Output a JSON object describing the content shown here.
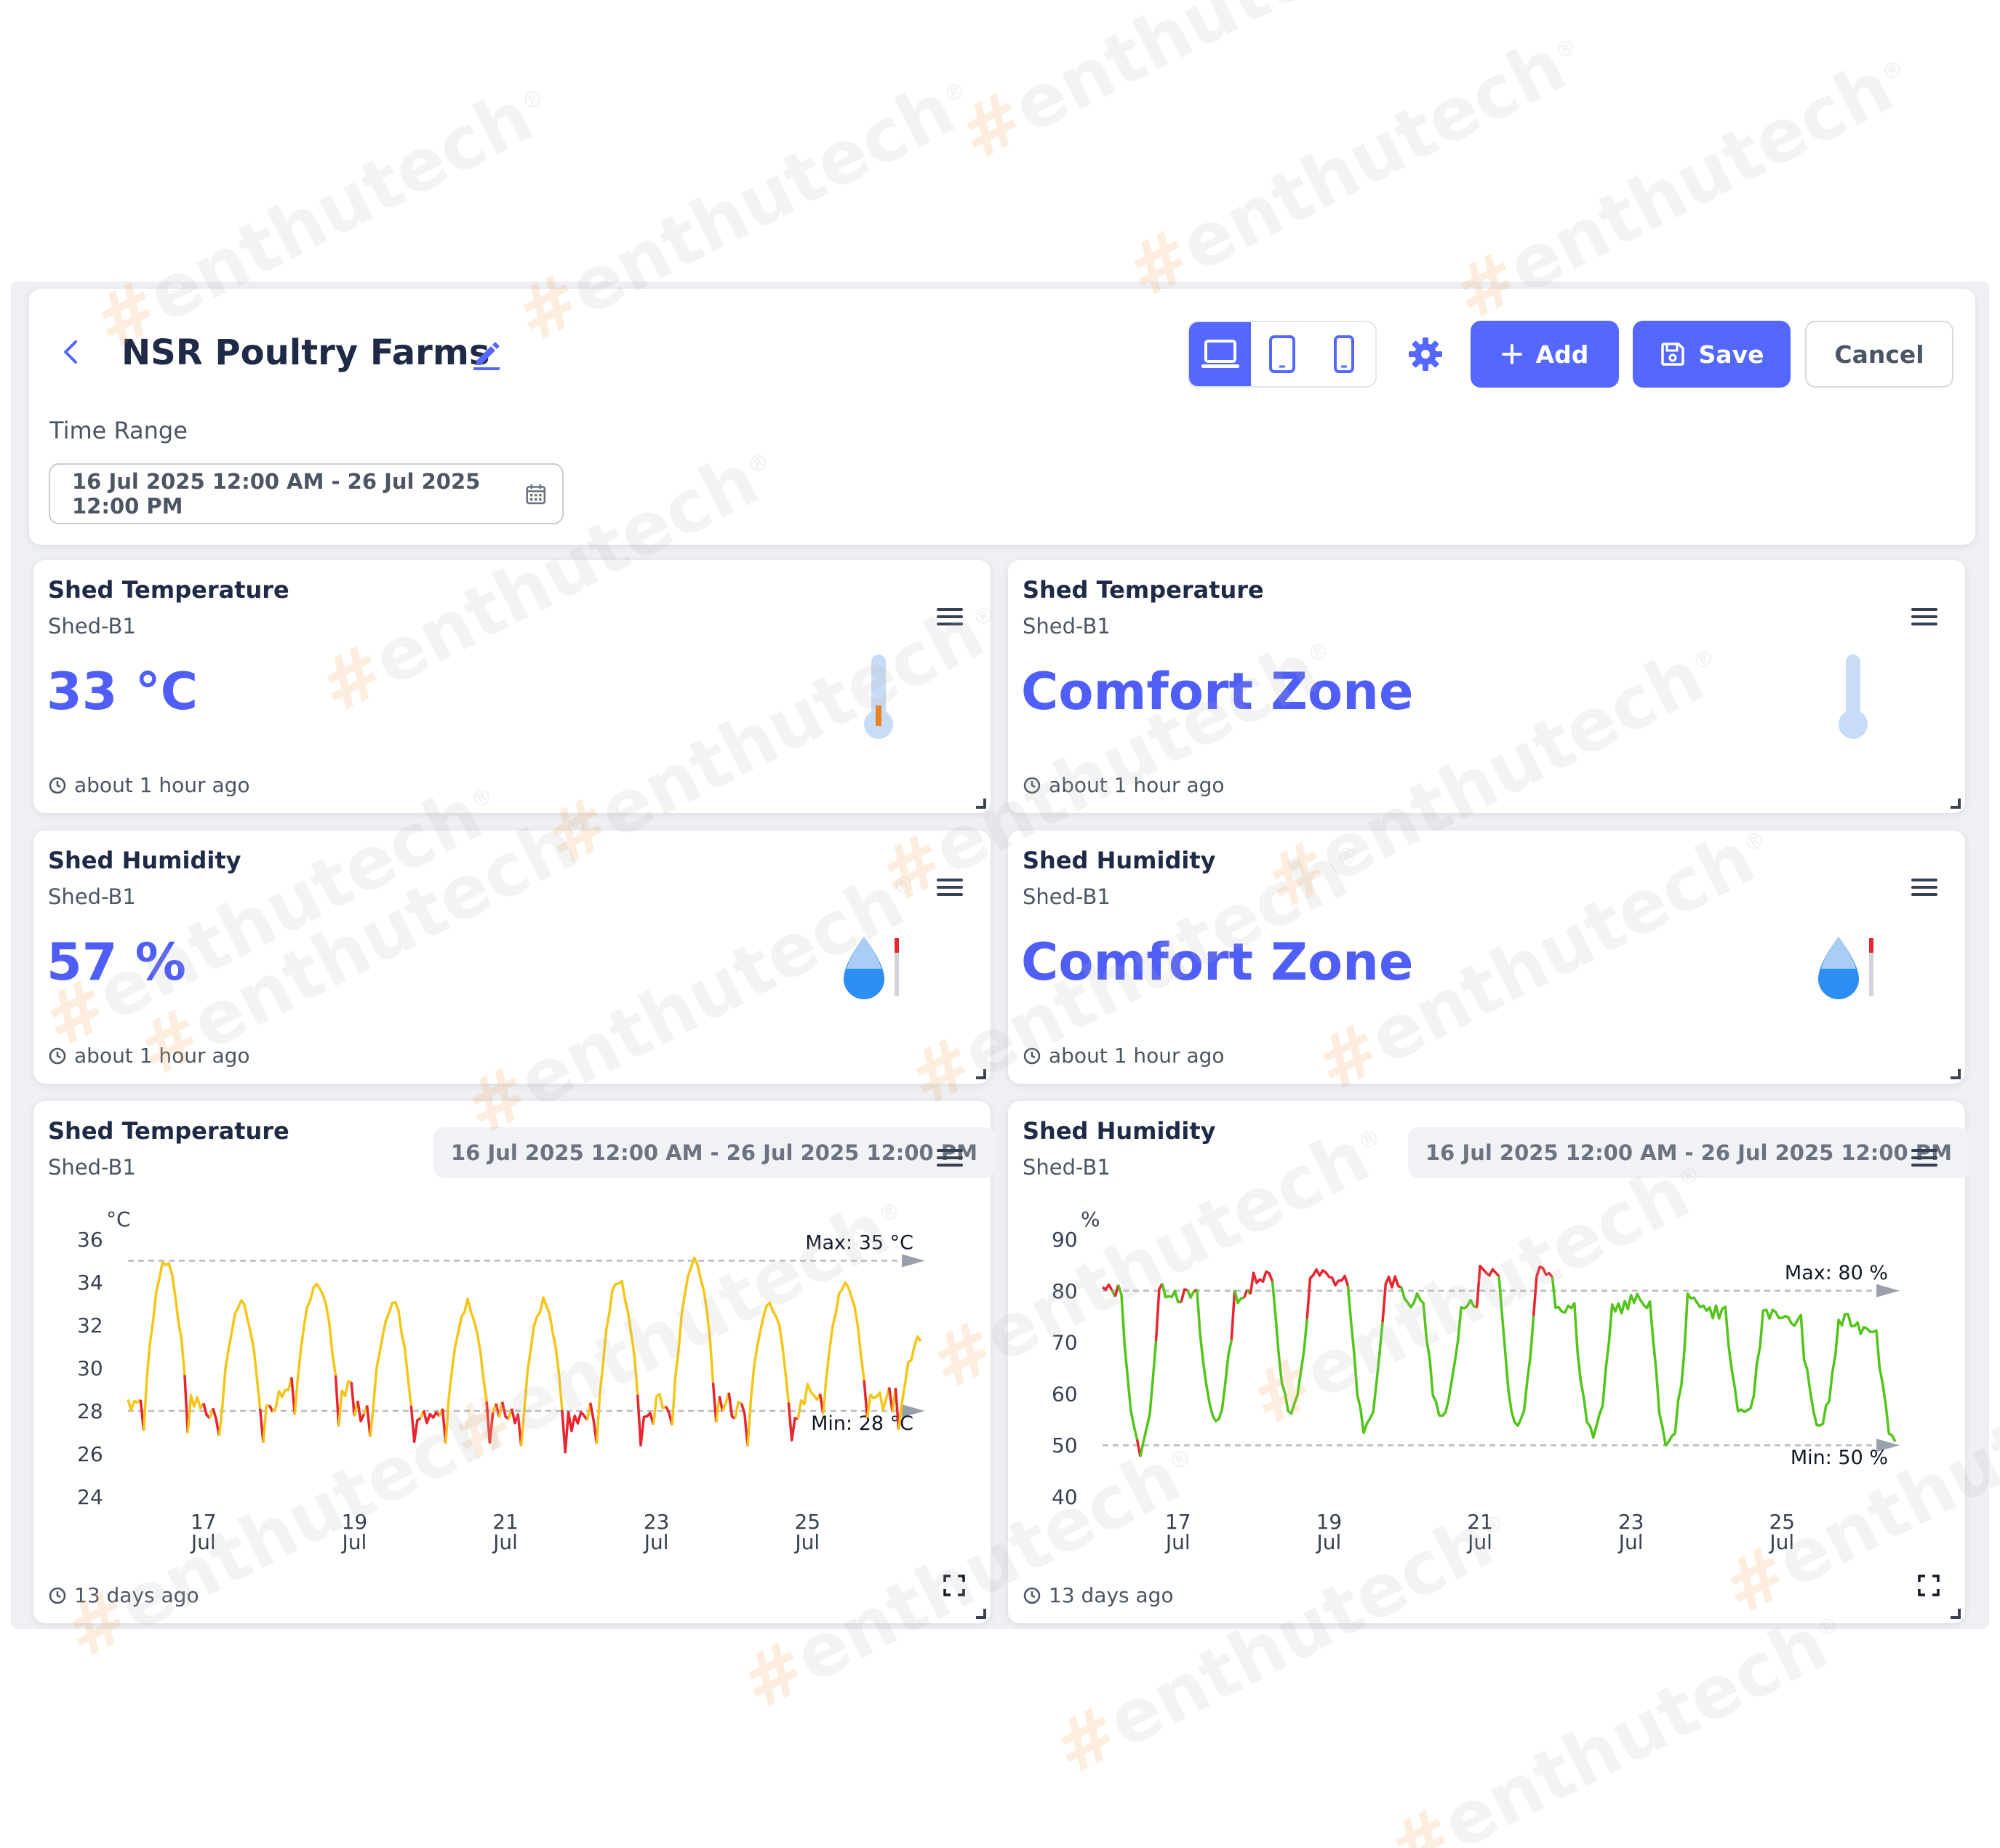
{
  "header": {
    "title": "NSR Poultry Farms",
    "add_label": "Add",
    "save_label": "Save",
    "cancel_label": "Cancel",
    "accent_color": "#5468ff"
  },
  "time_range": {
    "label": "Time Range",
    "value": "16 Jul 2025 12:00 AM - 26 Jul 2025 12:00 PM"
  },
  "widgets": {
    "temp_value": {
      "title": "Shed Temperature",
      "subtitle": "Shed-B1",
      "value": "33 °C",
      "updated": "about 1 hour ago"
    },
    "temp_zone": {
      "title": "Shed Temperature",
      "subtitle": "Shed-B1",
      "value": "Comfort Zone",
      "updated": "about 1 hour ago"
    },
    "hum_value": {
      "title": "Shed Humidity",
      "subtitle": "Shed-B1",
      "value": "57 %",
      "updated": "about 1 hour ago"
    },
    "hum_zone": {
      "title": "Shed Humidity",
      "subtitle": "Shed-B1",
      "value": "Comfort Zone",
      "updated": "about 1 hour ago"
    },
    "temp_chart": {
      "title": "Shed Temperature",
      "subtitle": "Shed-B1",
      "range": "16 Jul 2025 12:00 AM - 26 Jul 2025 12:00 PM",
      "updated": "13 days ago"
    },
    "hum_chart": {
      "title": "Shed Humidity",
      "subtitle": "Shed-B1",
      "range": "16 Jul 2025 12:00 AM - 26 Jul 2025 12:00 PM",
      "updated": "13 days ago"
    }
  },
  "watermark": {
    "hash": "#",
    "text": "enthutech",
    "mark": "®"
  },
  "chart_data": [
    {
      "type": "line",
      "title": "",
      "unit": "°C",
      "x_tick_days": [
        17,
        19,
        21,
        23,
        25
      ],
      "x_tick_month": "Jul",
      "ylim": [
        24,
        36
      ],
      "yticks": [
        24,
        26,
        28,
        30,
        32,
        34,
        36
      ],
      "max": {
        "value": 35,
        "label": "Max:  35 °C"
      },
      "min": {
        "value": 28,
        "label": "Min: 28 °C"
      },
      "color_above_min": "#f5c518",
      "color_below_min": "#e8242f",
      "x_start_day": 16,
      "x_end_day": 26.5,
      "day_peaks": [
        35,
        33,
        34,
        33,
        33,
        33,
        34,
        35,
        33,
        34,
        31.5
      ],
      "day_troughs": [
        26.5,
        26,
        27,
        26,
        26,
        25.5,
        26,
        26.5,
        26,
        27,
        26.5
      ]
    },
    {
      "type": "line",
      "title": "",
      "unit": "%",
      "x_tick_days": [
        17,
        19,
        21,
        23,
        25
      ],
      "x_tick_month": "Jul",
      "ylim": [
        40,
        90
      ],
      "yticks": [
        40,
        50,
        60,
        70,
        80,
        90
      ],
      "max": {
        "value": 80,
        "label": "Max:  80 %"
      },
      "min": {
        "value": 50,
        "label": "Min: 50 %"
      },
      "color_normal": "#52c41a",
      "color_alarm": "#e8242f",
      "x_start_day": 16,
      "x_end_day": 26.5,
      "day_peaks": [
        80,
        79,
        83,
        82,
        78,
        84,
        77,
        78,
        76,
        74,
        73
      ],
      "day_troughs": [
        49,
        55,
        56,
        53,
        55,
        54,
        52,
        50,
        55,
        54,
        51
      ]
    }
  ]
}
